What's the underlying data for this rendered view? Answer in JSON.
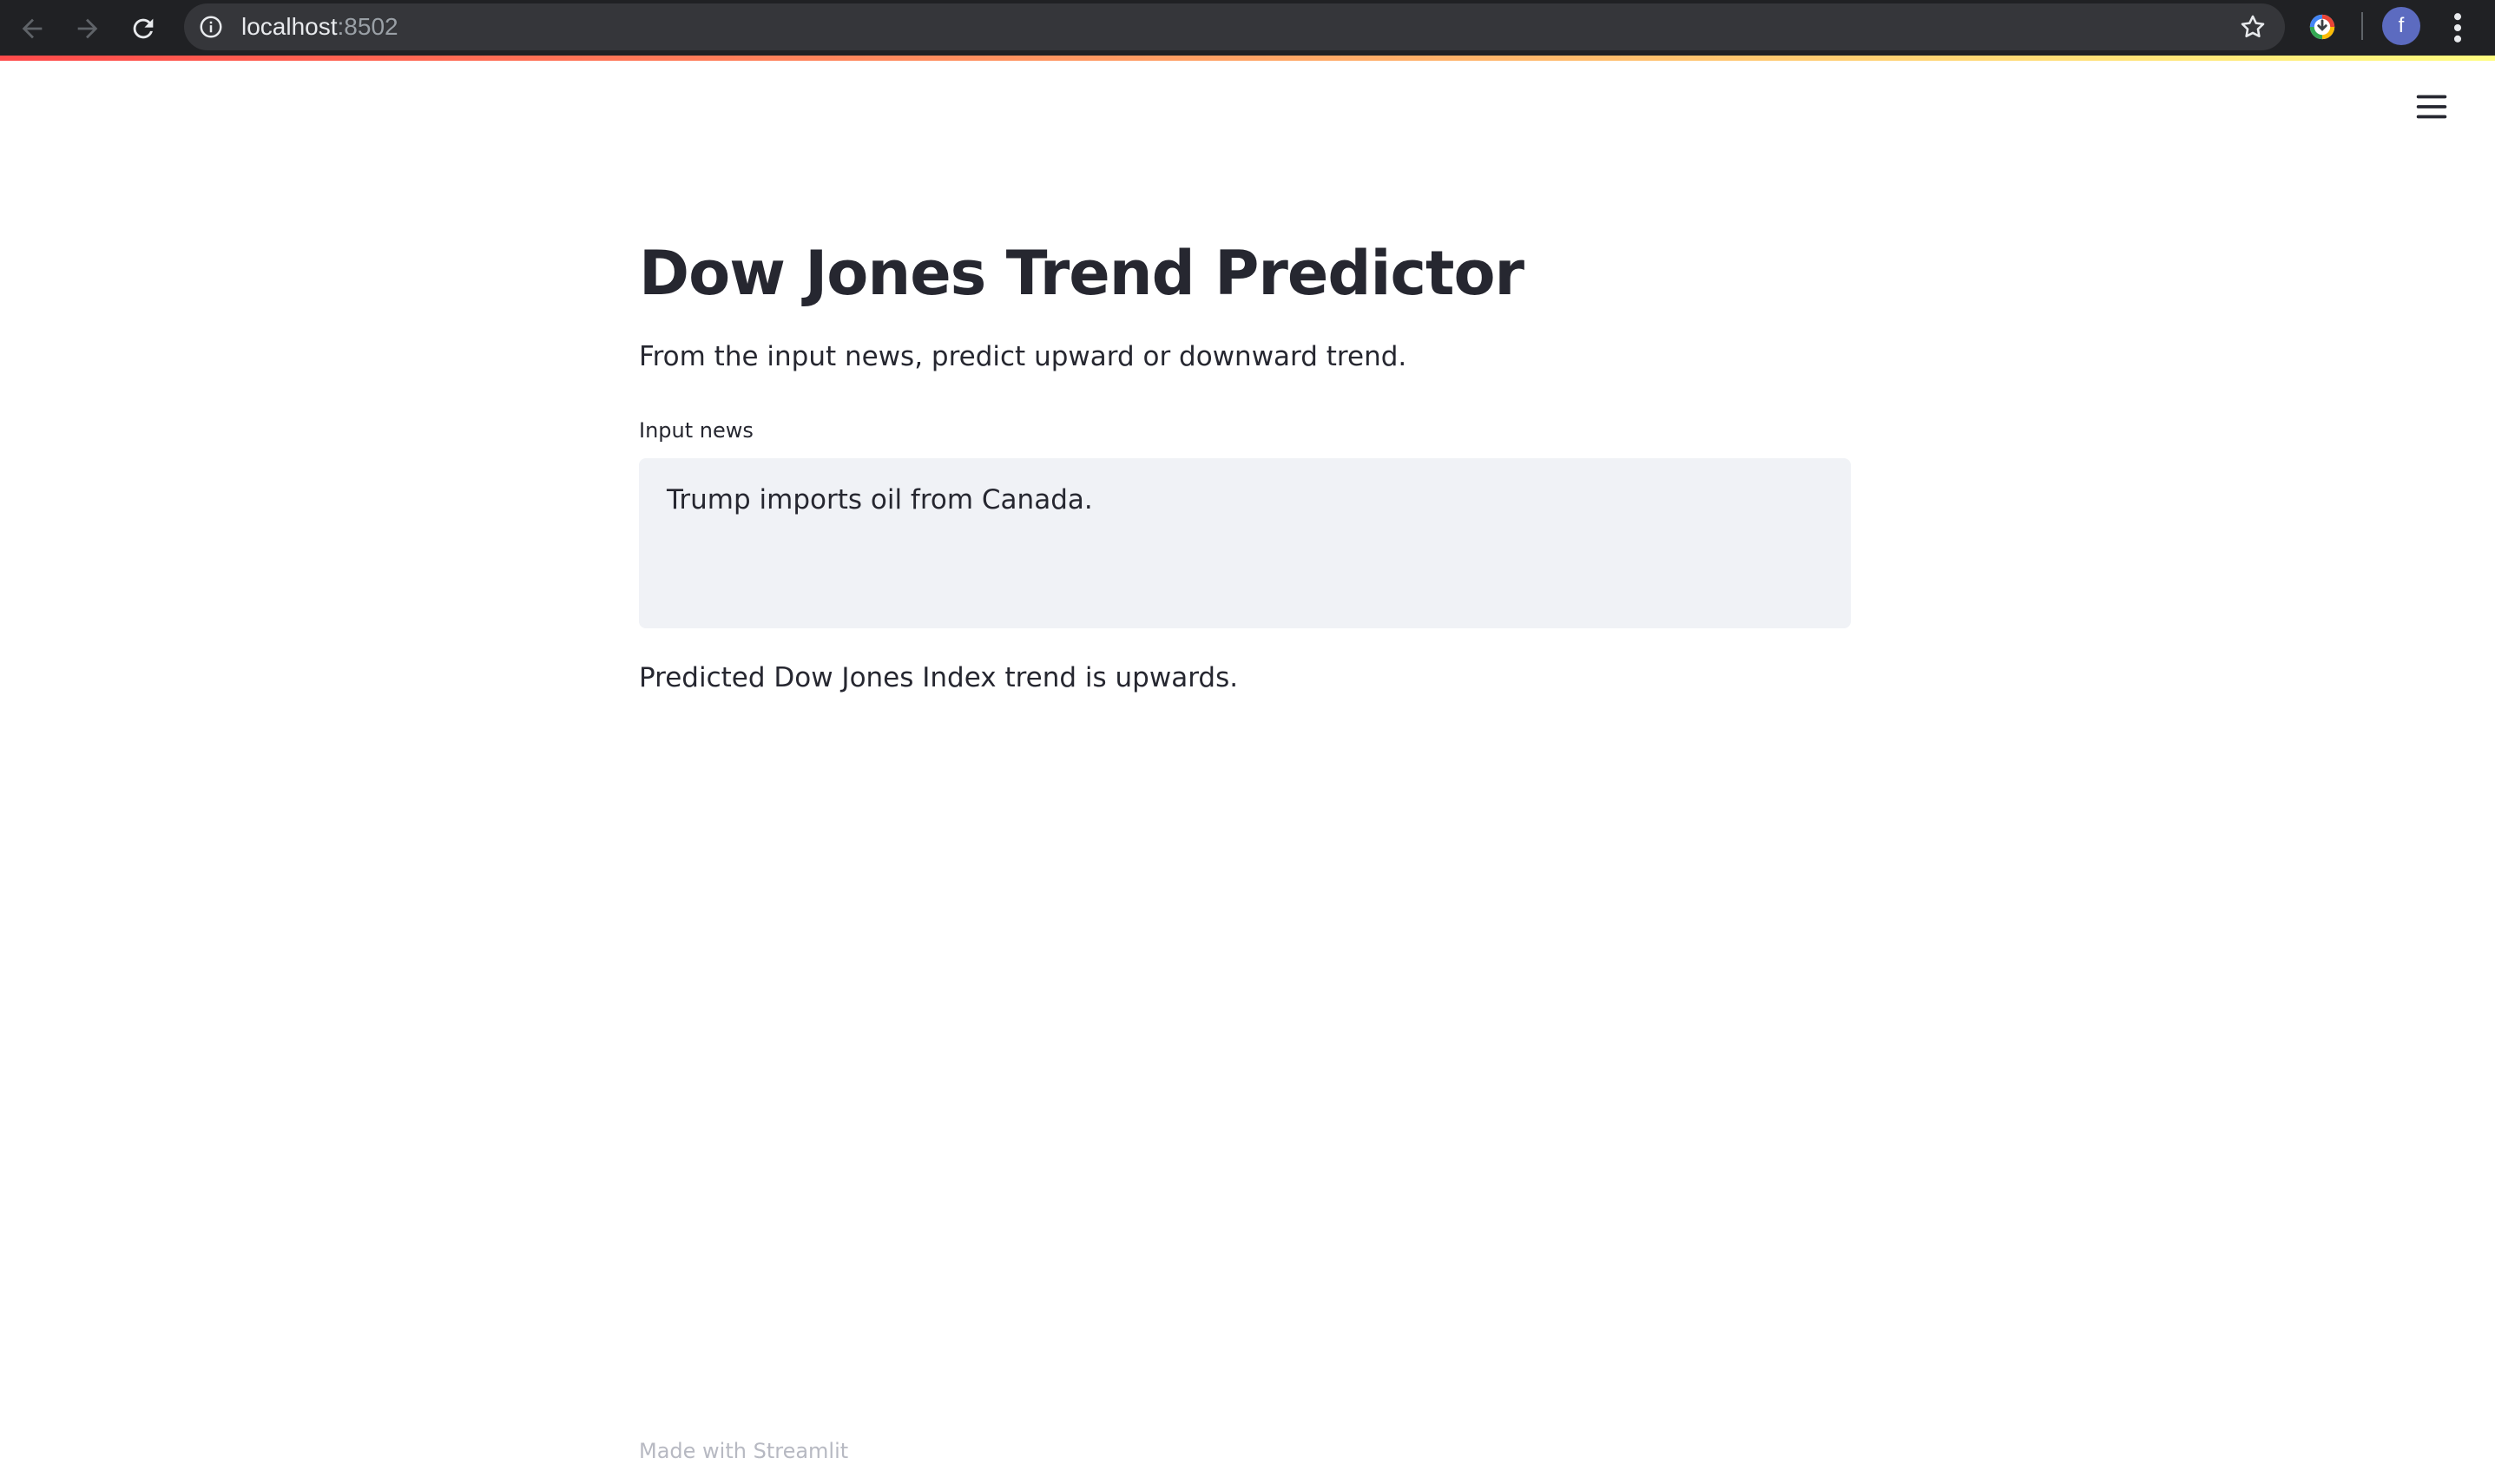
{
  "browser": {
    "url_host": "localhost",
    "url_port": ":8502",
    "profile_initial": "f"
  },
  "app": {
    "title": "Dow Jones Trend Predictor",
    "subtitle": "From the input news, predict upward or downward trend.",
    "input_label": "Input news",
    "input_value": "Trump imports oil from Canada.",
    "result_text": "Predicted Dow Jones Index trend is upwards.",
    "footer": "Made with Streamlit"
  },
  "colors": {
    "browser_bar": "#202124",
    "omnibox": "#35363a",
    "text_primary": "#262730",
    "input_bg": "#f0f2f6",
    "footer_text": "#b7b9c2",
    "accent_start": "#ff4b4b",
    "accent_end": "#fffd80",
    "avatar": "#5c6bc0"
  },
  "icons": [
    "back-arrow-icon",
    "forward-arrow-icon",
    "reload-icon",
    "info-icon",
    "star-icon",
    "extension-icon",
    "menu-dots-icon",
    "hamburger-menu-icon"
  ]
}
